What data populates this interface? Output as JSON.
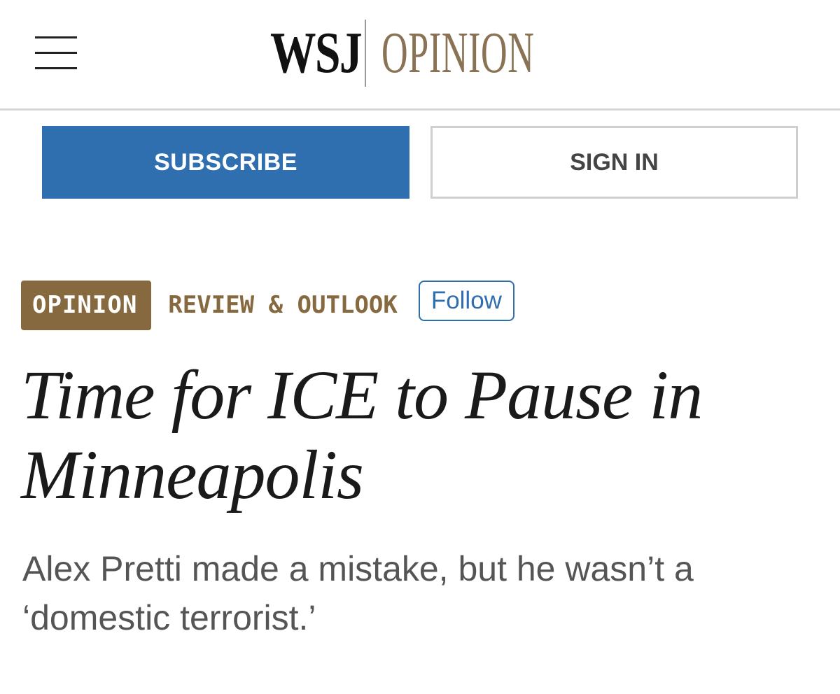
{
  "header": {
    "menu_icon": "hamburger-menu-icon",
    "logo_primary": "WSJ",
    "logo_secondary": "OPINION"
  },
  "auth": {
    "subscribe_label": "SUBSCRIBE",
    "signin_label": "SIGN IN"
  },
  "article": {
    "section_tag": "OPINION",
    "section_name": "REVIEW & OUTLOOK",
    "follow_label": "Follow",
    "headline": "Time for ICE to Pause in Minneapolis",
    "dek": "Alex Pretti made a mistake, but he wasn’t a ‘domestic terrorist.’"
  },
  "colors": {
    "accent_blue": "#2f6fb0",
    "opinion_gold": "#86693f",
    "logo_gold": "#8a7355"
  }
}
